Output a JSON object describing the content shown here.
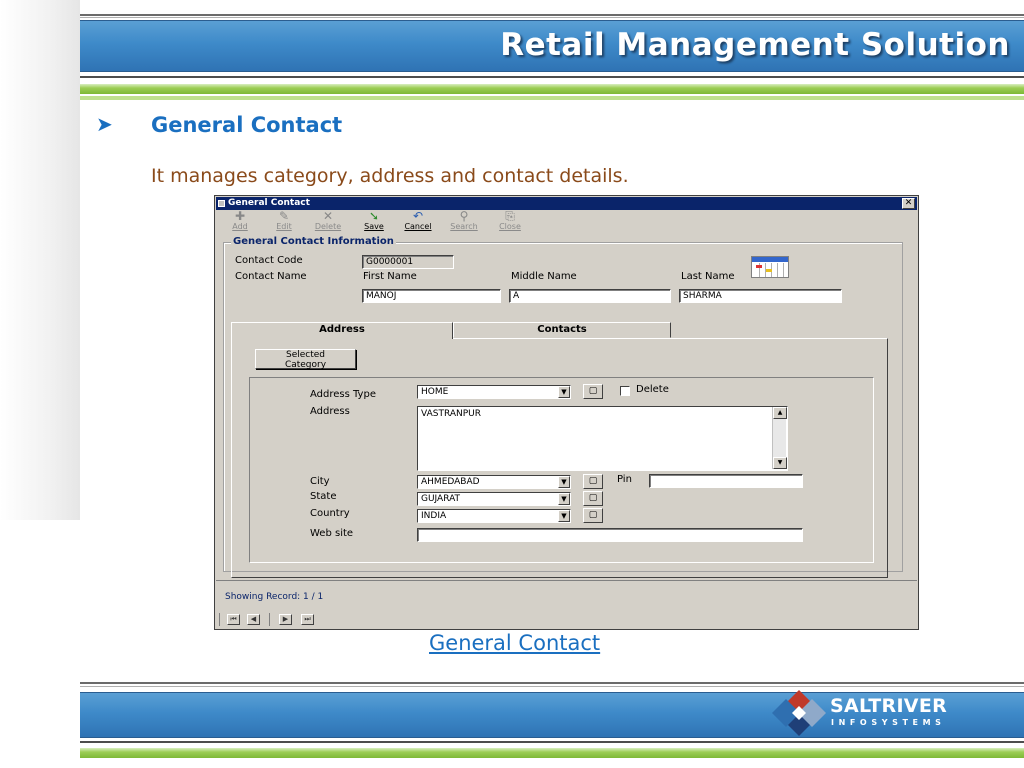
{
  "slide": {
    "header_title": "Retail Management Solution",
    "bullet": "➤",
    "heading": "General Contact",
    "subtext": "It manages category, address and contact details.",
    "caption": "General Contact",
    "logo_main": "SALTRIVER",
    "logo_sub": "INFOSYSTEMS"
  },
  "window": {
    "title": "General Contact",
    "close": "✕",
    "toolbar": [
      {
        "label": "Add",
        "icon": "✚",
        "icon_name": "add-icon",
        "enabled": false
      },
      {
        "label": "Edit",
        "icon": "✎",
        "icon_name": "edit-icon",
        "enabled": false
      },
      {
        "label": "Delete",
        "icon": "✕",
        "icon_name": "delete-icon",
        "enabled": false
      },
      {
        "label": "Save",
        "icon": "➘",
        "icon_name": "save-icon",
        "enabled": true
      },
      {
        "label": "Cancel",
        "icon": "↶",
        "icon_name": "cancel-icon",
        "enabled": true
      },
      {
        "label": "Search",
        "icon": "⚲",
        "icon_name": "search-icon",
        "enabled": false
      },
      {
        "label": "Close",
        "icon": "⎘",
        "icon_name": "close-icon",
        "enabled": false
      }
    ],
    "group_title": "General Contact Information",
    "contact_code_label": "Contact Code",
    "contact_code_value": "G0000001",
    "contact_name_label": "Contact Name",
    "first_name_label": "First Name",
    "middle_name_label": "Middle Name",
    "last_name_label": "Last Name",
    "first_name_value": "MANOJ",
    "middle_name_value": "A",
    "last_name_value": "SHARMA",
    "tabs": [
      {
        "label": "Address",
        "active": true
      },
      {
        "label": "Contacts",
        "active": false
      }
    ],
    "selected_category_line1": "Selected",
    "selected_category_line2": "Category",
    "address_type_label": "Address Type",
    "address_type_value": "HOME",
    "delete_checkbox_label": "Delete",
    "address_label": "Address",
    "address_value": "VASTRANPUR",
    "city_label": "City",
    "city_value": "AHMEDABAD",
    "pin_label": "Pin",
    "pin_value": "",
    "state_label": "State",
    "state_value": "GUJARAT",
    "country_label": "Country",
    "country_value": "INDIA",
    "website_label": "Web site",
    "website_value": "",
    "status": "Showing Record: 1 / 1",
    "nav": {
      "first": "⏮",
      "prev": "◀",
      "next": "▶",
      "last": "⏭"
    }
  }
}
